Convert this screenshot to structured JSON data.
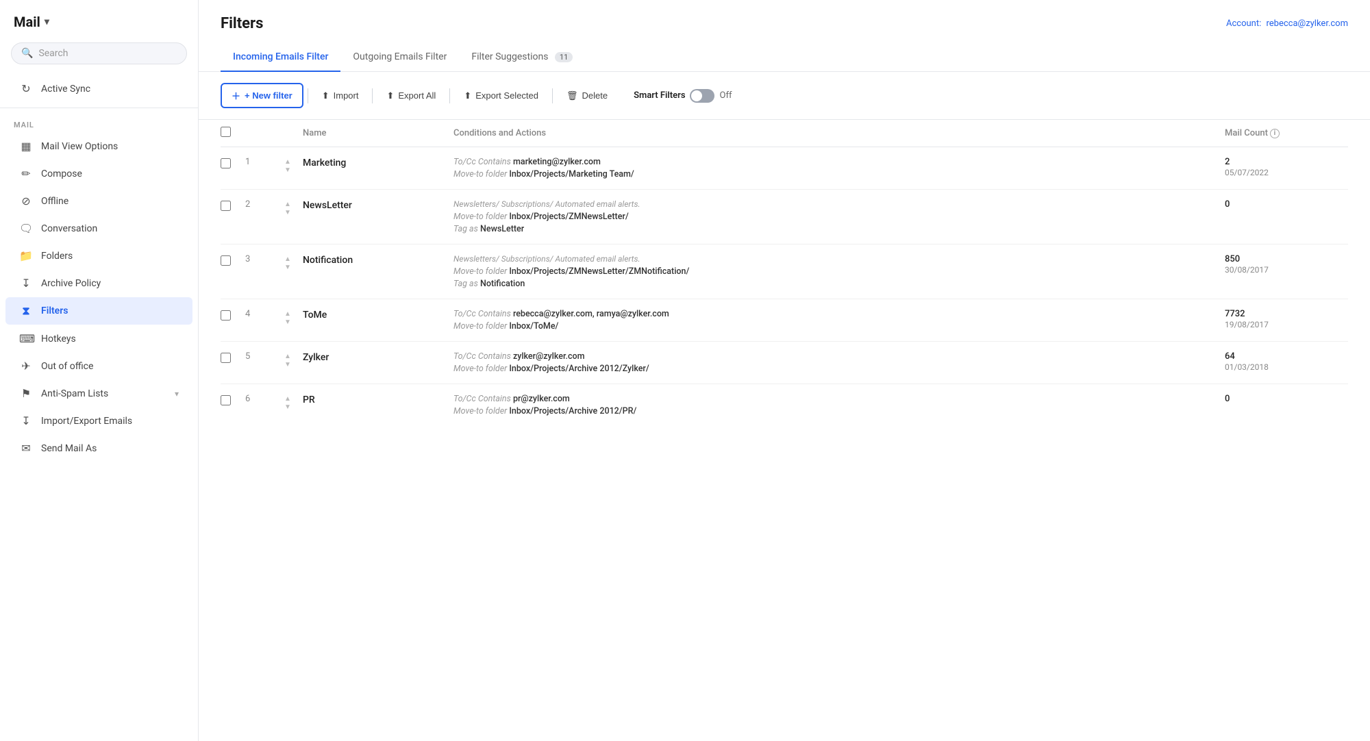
{
  "sidebar": {
    "app_title": "Mail",
    "search_placeholder": "Search",
    "active_sync": "Active Sync",
    "section_label": "MAIL",
    "items": [
      {
        "id": "mail-view-options",
        "label": "Mail View Options",
        "icon": "⊞",
        "active": false
      },
      {
        "id": "compose",
        "label": "Compose",
        "icon": "✏️",
        "active": false
      },
      {
        "id": "offline",
        "label": "Offline",
        "icon": "⊘",
        "active": false
      },
      {
        "id": "conversation",
        "label": "Conversation",
        "icon": "💬",
        "active": false
      },
      {
        "id": "folders",
        "label": "Folders",
        "icon": "📁",
        "active": false
      },
      {
        "id": "archive-policy",
        "label": "Archive Policy",
        "icon": "⬇",
        "active": false
      },
      {
        "id": "filters",
        "label": "Filters",
        "icon": "⧖",
        "active": true
      },
      {
        "id": "hotkeys",
        "label": "Hotkeys",
        "icon": "⌨",
        "active": false
      },
      {
        "id": "out-of-office",
        "label": "Out of office",
        "icon": "✈",
        "active": false
      },
      {
        "id": "anti-spam",
        "label": "Anti-Spam Lists",
        "icon": "🛡",
        "active": false,
        "has_arrow": true
      },
      {
        "id": "import-export",
        "label": "Import/Export Emails",
        "icon": "⬇",
        "active": false
      },
      {
        "id": "send-mail-as",
        "label": "Send Mail As",
        "icon": "📨",
        "active": false
      }
    ]
  },
  "main": {
    "title": "Filters",
    "account_label": "Account:",
    "account_email": "rebecca@zylker.com",
    "tabs": [
      {
        "id": "incoming",
        "label": "Incoming Emails Filter",
        "active": true,
        "badge": null
      },
      {
        "id": "outgoing",
        "label": "Outgoing Emails Filter",
        "active": false,
        "badge": null
      },
      {
        "id": "suggestions",
        "label": "Filter Suggestions",
        "active": false,
        "badge": "11"
      }
    ],
    "toolbar": {
      "new_filter": "+ New filter",
      "import": "Import",
      "export_all": "Export All",
      "export_selected": "Export Selected",
      "delete": "Delete",
      "smart_filters": "Smart Filters",
      "toggle_state": "Off"
    },
    "table": {
      "headers": {
        "name": "Name",
        "conditions": "Conditions and Actions",
        "mail_count": "Mail Count"
      },
      "rows": [
        {
          "num": 1,
          "name": "Marketing",
          "conditions": [
            {
              "key": "To/Cc Contains",
              "val": "marketing@zylker.com"
            },
            {
              "key": "Move-to folder",
              "val": "Inbox/Projects/Marketing Team/"
            }
          ],
          "count": "2",
          "date": "05/07/2022"
        },
        {
          "num": 2,
          "name": "NewsLetter",
          "conditions": [
            {
              "key": "",
              "val": "Newsletters/ Subscriptions/ Automated email alerts."
            },
            {
              "key": "Move-to folder",
              "val": "Inbox/Projects/ZMNewsLetter/"
            },
            {
              "key": "Tag as",
              "val": "NewsLetter"
            }
          ],
          "count": "0",
          "date": ""
        },
        {
          "num": 3,
          "name": "Notification",
          "conditions": [
            {
              "key": "",
              "val": "Newsletters/ Subscriptions/ Automated email alerts."
            },
            {
              "key": "Move-to folder",
              "val": "Inbox/Projects/ZMNewsLetter/ZMNotification/"
            },
            {
              "key": "Tag as",
              "val": "Notification"
            }
          ],
          "count": "850",
          "date": "30/08/2017"
        },
        {
          "num": 4,
          "name": "ToMe",
          "conditions": [
            {
              "key": "To/Cc Contains",
              "val": "rebecca@zylker.com, ramya@zylker.com"
            },
            {
              "key": "Move-to folder",
              "val": "Inbox/ToMe/"
            }
          ],
          "count": "7732",
          "date": "19/08/2017"
        },
        {
          "num": 5,
          "name": "Zylker",
          "conditions": [
            {
              "key": "To/Cc Contains",
              "val": "zylker@zylker.com"
            },
            {
              "key": "Move-to folder",
              "val": "Inbox/Projects/Archive 2012/Zylker/"
            }
          ],
          "count": "64",
          "date": "01/03/2018"
        },
        {
          "num": 6,
          "name": "PR",
          "conditions": [
            {
              "key": "To/Cc Contains",
              "val": "pr@zylker.com"
            },
            {
              "key": "Move-to folder",
              "val": "Inbox/Projects/Archive 2012/PR/"
            }
          ],
          "count": "0",
          "date": ""
        }
      ]
    }
  }
}
